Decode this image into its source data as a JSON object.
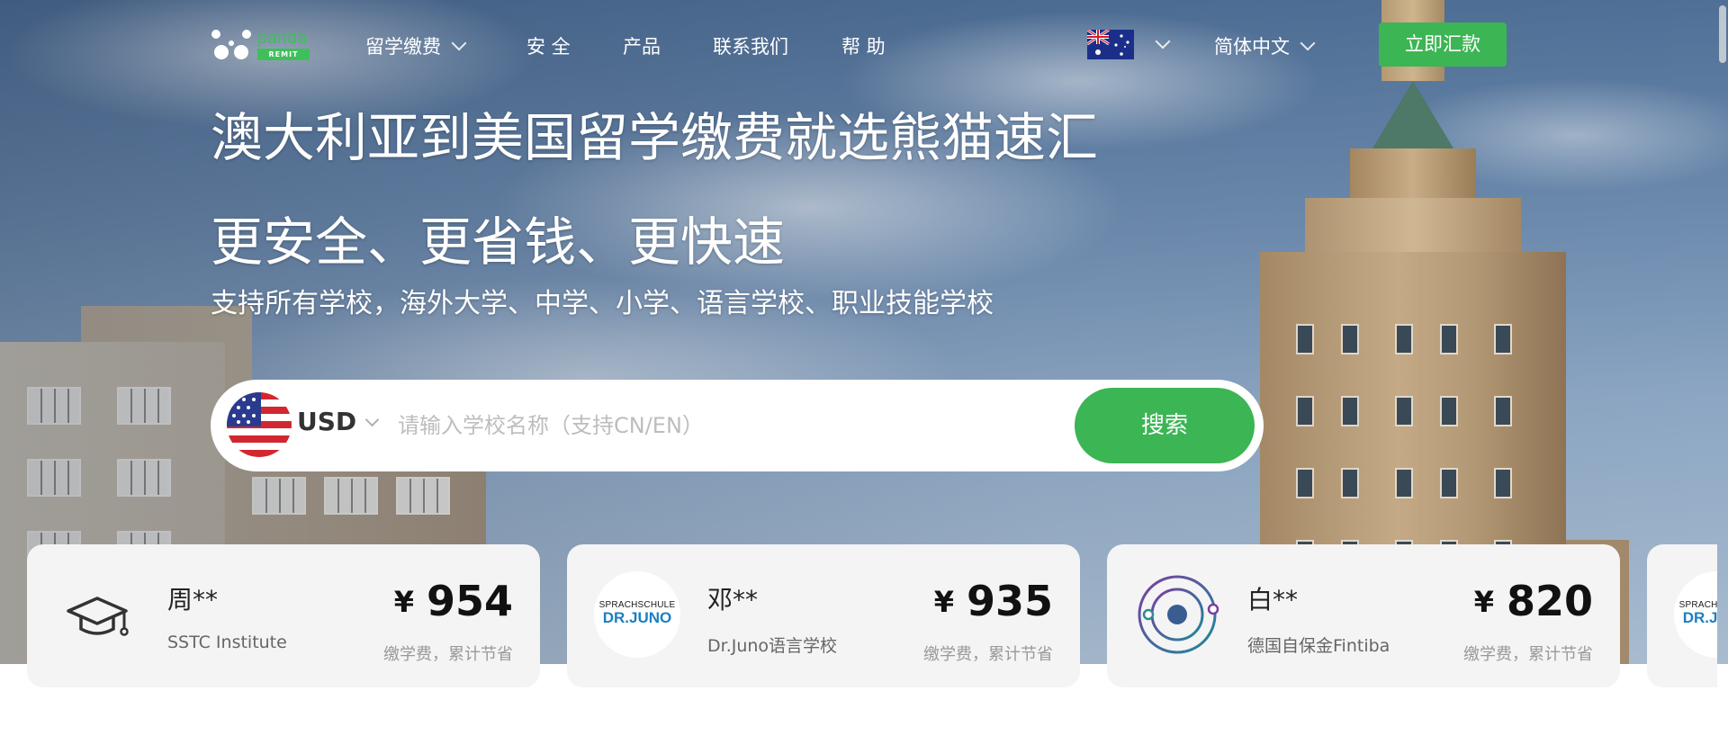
{
  "nav": {
    "logo_text": "panda",
    "logo_sub": "REMIT",
    "items": [
      {
        "label": "留学缴费",
        "has_dropdown": true
      },
      {
        "label": "安 全"
      },
      {
        "label": "产品"
      },
      {
        "label": "联系我们"
      },
      {
        "label": "帮 助"
      }
    ],
    "country_flag": "australia-flag",
    "language": "简体中文",
    "cta_label": "立即汇款"
  },
  "hero": {
    "title": "澳大利亚到美国留学缴费就选熊猫速汇",
    "subtitle": "更安全、更省钱、更快速",
    "tagline": "支持所有学校，海外大学、中学、小学、语言学校、职业技能学校"
  },
  "search": {
    "currency": "USD",
    "currency_flag": "usa-flag",
    "placeholder": "请输入学校名称（支持CN/EN）",
    "value": "",
    "button_label": "搜索"
  },
  "cards": [
    {
      "icon": "graduation-cap-icon",
      "name": "周**",
      "school": "SSTC Institute",
      "currency_symbol": "¥",
      "amount": "954",
      "note": "缴学费，累计节省"
    },
    {
      "icon": "drjuno-logo",
      "logo_line1": "SPRACHSCHULE",
      "logo_line2": "DR.JUNO",
      "name": "邓**",
      "school": "Dr.Juno语言学校",
      "currency_symbol": "¥",
      "amount": "935",
      "note": "缴学费，累计节省"
    },
    {
      "icon": "fintiba-logo",
      "name": "白**",
      "school": "德国自保金Fintiba",
      "currency_symbol": "¥",
      "amount": "820",
      "note": "缴学费，累计节省"
    },
    {
      "icon": "drjuno-logo",
      "logo_line1": "SPRACHSCHULE",
      "logo_line2": "DR.JUNO"
    }
  ],
  "colors": {
    "brand_green": "#3cb554",
    "text_dark": "#222222",
    "text_muted": "#999999",
    "card_bg": "#f4f4f4"
  }
}
